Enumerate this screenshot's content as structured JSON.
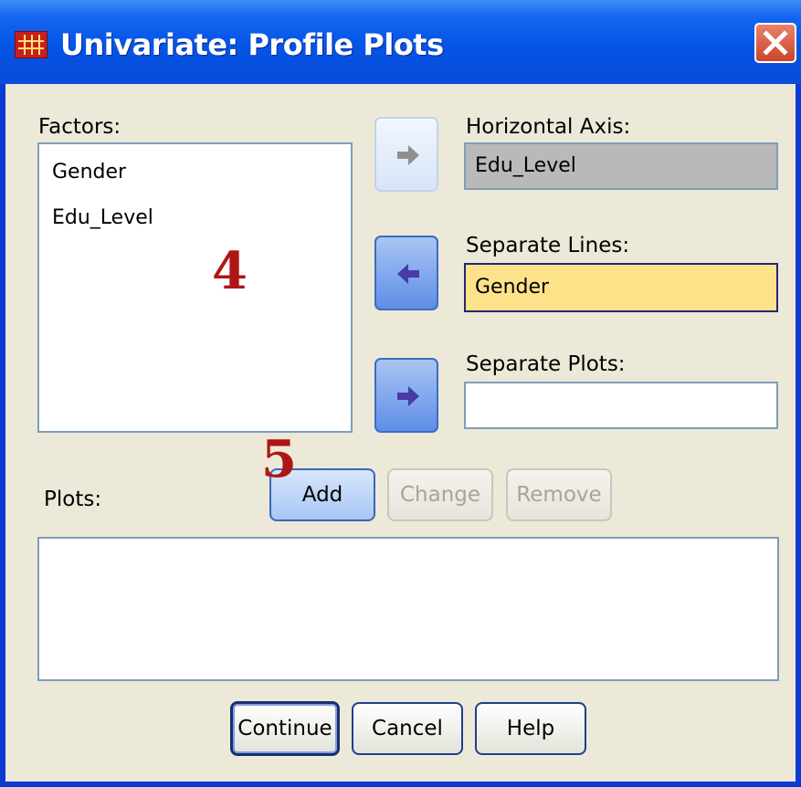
{
  "window": {
    "title": "Univariate: Profile Plots",
    "colors": {
      "titlebar": "#0454e6",
      "client": "#ece9d8",
      "close": "#d2553a",
      "annotation": "#b01515",
      "selected_field": "#fde28a",
      "disabled_field": "#b9b9b9"
    }
  },
  "factors": {
    "label": "Factors:",
    "items": [
      "Gender",
      "Edu_Level"
    ]
  },
  "horizontal_axis": {
    "label": "Horizontal Axis:",
    "value": "Edu_Level"
  },
  "separate_lines": {
    "label": "Separate Lines:",
    "value": "Gender"
  },
  "separate_plots": {
    "label": "Separate Plots:",
    "value": ""
  },
  "arrows": {
    "horizontal": "arrow-right-icon",
    "lines": "arrow-left-icon",
    "plots": "arrow-right-icon"
  },
  "plots": {
    "label": "Plots:",
    "add": "Add",
    "change": "Change",
    "remove": "Remove"
  },
  "footer": {
    "continue": "Continue",
    "cancel": "Cancel",
    "help": "Help"
  },
  "annotations": {
    "four": "4",
    "five": "5"
  }
}
